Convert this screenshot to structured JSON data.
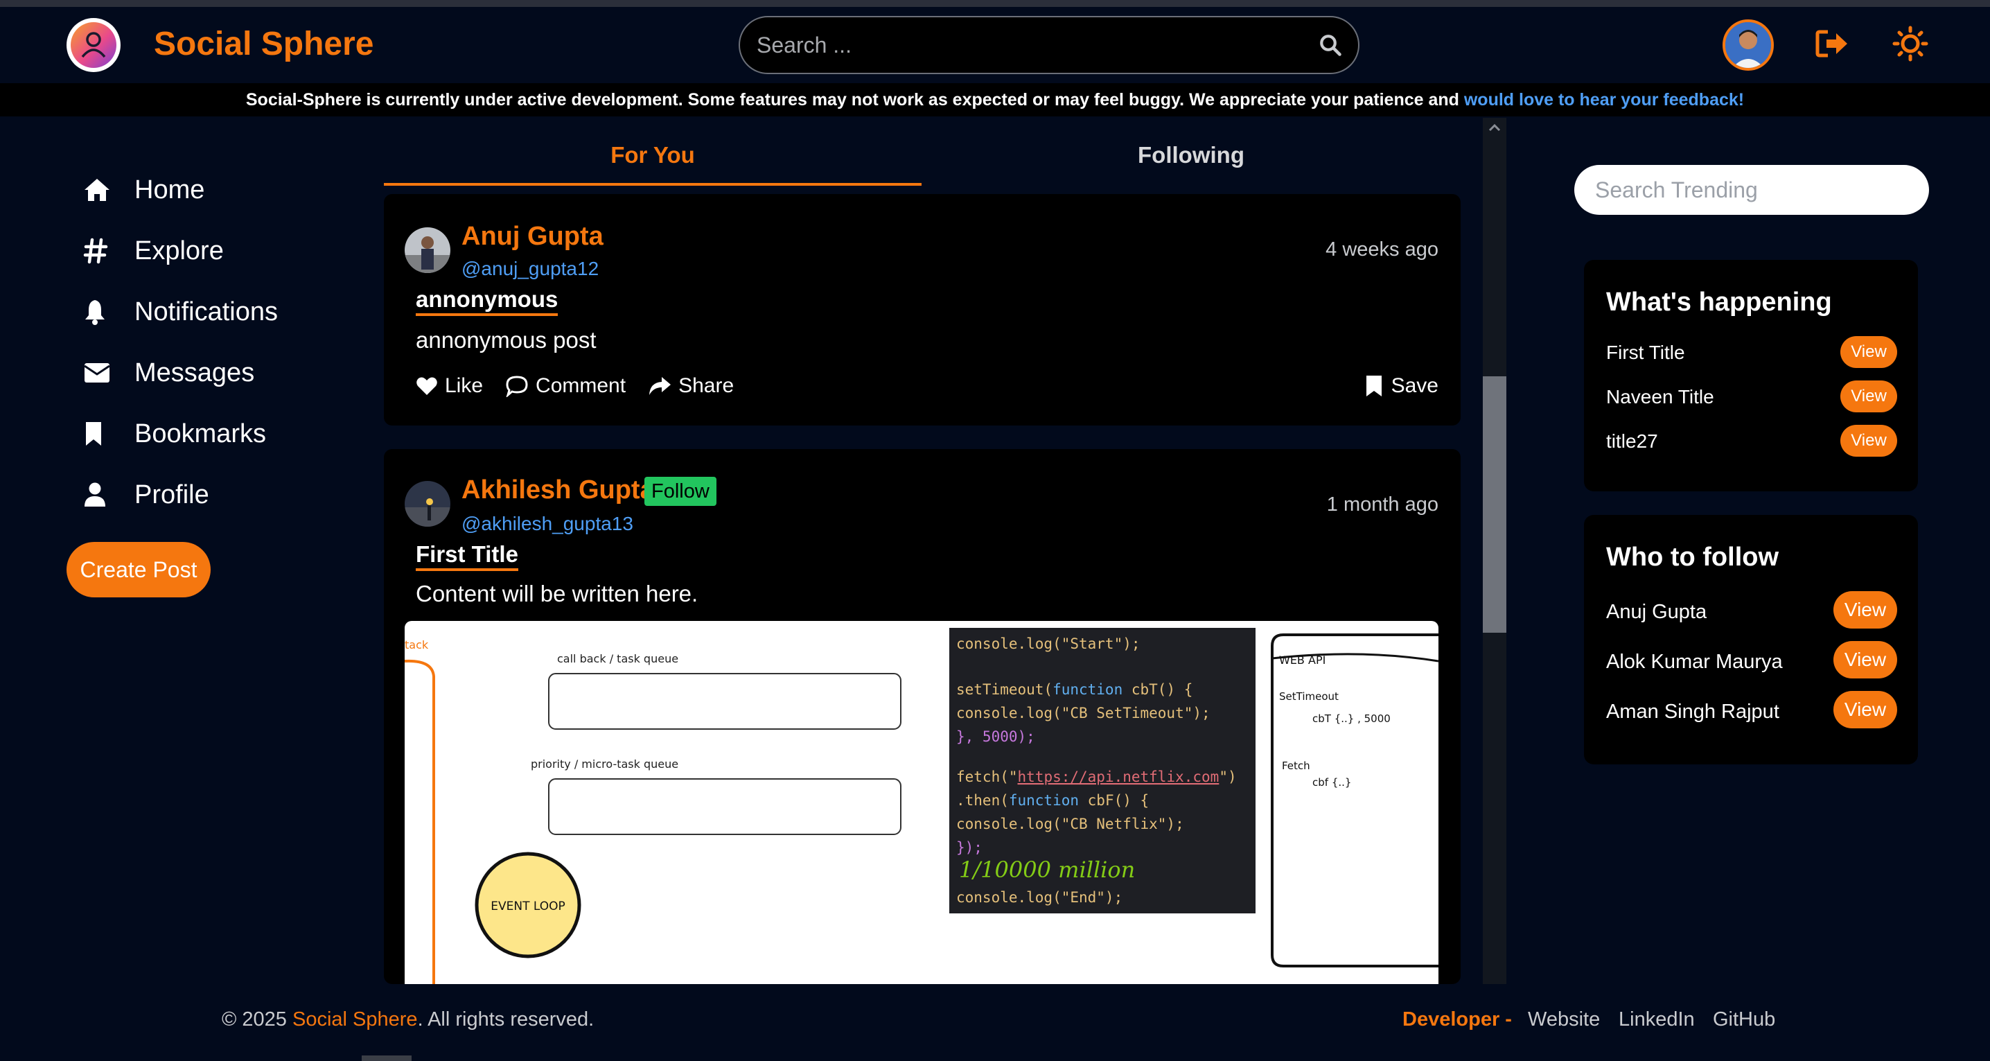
{
  "header": {
    "brand": "Social Sphere",
    "search_placeholder": "Search ..."
  },
  "banner": {
    "text": "Social-Sphere is currently under active development. Some features may not work as expected or may feel buggy. We appreciate your patience and ",
    "link": "would love to hear your feedback!"
  },
  "sidebar": {
    "items": [
      {
        "label": "Home",
        "icon": "home-icon"
      },
      {
        "label": "Explore",
        "icon": "hashtag-icon"
      },
      {
        "label": "Notifications",
        "icon": "bell-icon"
      },
      {
        "label": "Messages",
        "icon": "envelope-icon"
      },
      {
        "label": "Bookmarks",
        "icon": "bookmark-icon"
      },
      {
        "label": "Profile",
        "icon": "user-icon"
      }
    ],
    "create_post": "Create Post"
  },
  "tabs": {
    "for_you": "For You",
    "following": "Following"
  },
  "posts": [
    {
      "name": "Anuj Gupta",
      "handle": "@anuj_gupta12",
      "time": "4 weeks ago",
      "title": "annonymous",
      "body": "annonymous post",
      "actions": {
        "like": "Like",
        "comment": "Comment",
        "share": "Share",
        "save": "Save"
      }
    },
    {
      "name": "Akhilesh Gupta",
      "follow": "Follow",
      "handle": "@akhilesh_gupta13",
      "time": "1 month ago",
      "title": "First Title",
      "body": "Content will be written here.",
      "image": {
        "stack_label": "tack",
        "callback_queue": "call back / task queue",
        "micro_queue": "priority / micro-task queue",
        "event_loop": "EVENT LOOP",
        "code": {
          "line1": "console.log(\"Start\");",
          "set_timeout": "setTimeout(",
          "fn_kw": "function",
          "fn1": " cbT() {",
          "cb_settimeout": "  console.log(\"CB SetTimeout\");",
          "close1": "}, 5000);",
          "fetch": "fetch(\"",
          "url": "https://api.netflix.com",
          "fetch_end": "\")",
          "then": ".then(",
          "fn2": " cbF() {",
          "cb_netflix": "  console.log(\"CB Netflix\");",
          "close2": "});",
          "scribble": "1/10000 million",
          "end": "console.log(\"End\");"
        },
        "web_api": "WEB API",
        "settimeout": "SetTimeout",
        "cbt": "cbT {..} , 5000",
        "fetch_label": "Fetch",
        "cbf": "cbf {..}"
      }
    }
  ],
  "trending": {
    "search_placeholder": "Search Trending",
    "heading": "What's happening",
    "items": [
      {
        "title": "First Title",
        "action": "View"
      },
      {
        "title": "Naveen Title",
        "action": "View"
      },
      {
        "title": "title27",
        "action": "View"
      }
    ]
  },
  "who_to_follow": {
    "heading": "Who to follow",
    "items": [
      {
        "name": "Anuj Gupta",
        "action": "View"
      },
      {
        "name": "Alok Kumar Maurya",
        "action": "View"
      },
      {
        "name": "Aman Singh Rajput",
        "action": "View"
      }
    ]
  },
  "footer": {
    "copyright_prefix": "© 2025 ",
    "brand": "Social Sphere",
    "copyright_suffix": ". All rights reserved.",
    "developer": "Developer -",
    "links": [
      "Website",
      "LinkedIn",
      "GitHub"
    ]
  },
  "colors": {
    "accent": "#f5770f",
    "link": "#4f9ef5",
    "background": "#020a1c",
    "follow_badge": "#22c55e"
  }
}
